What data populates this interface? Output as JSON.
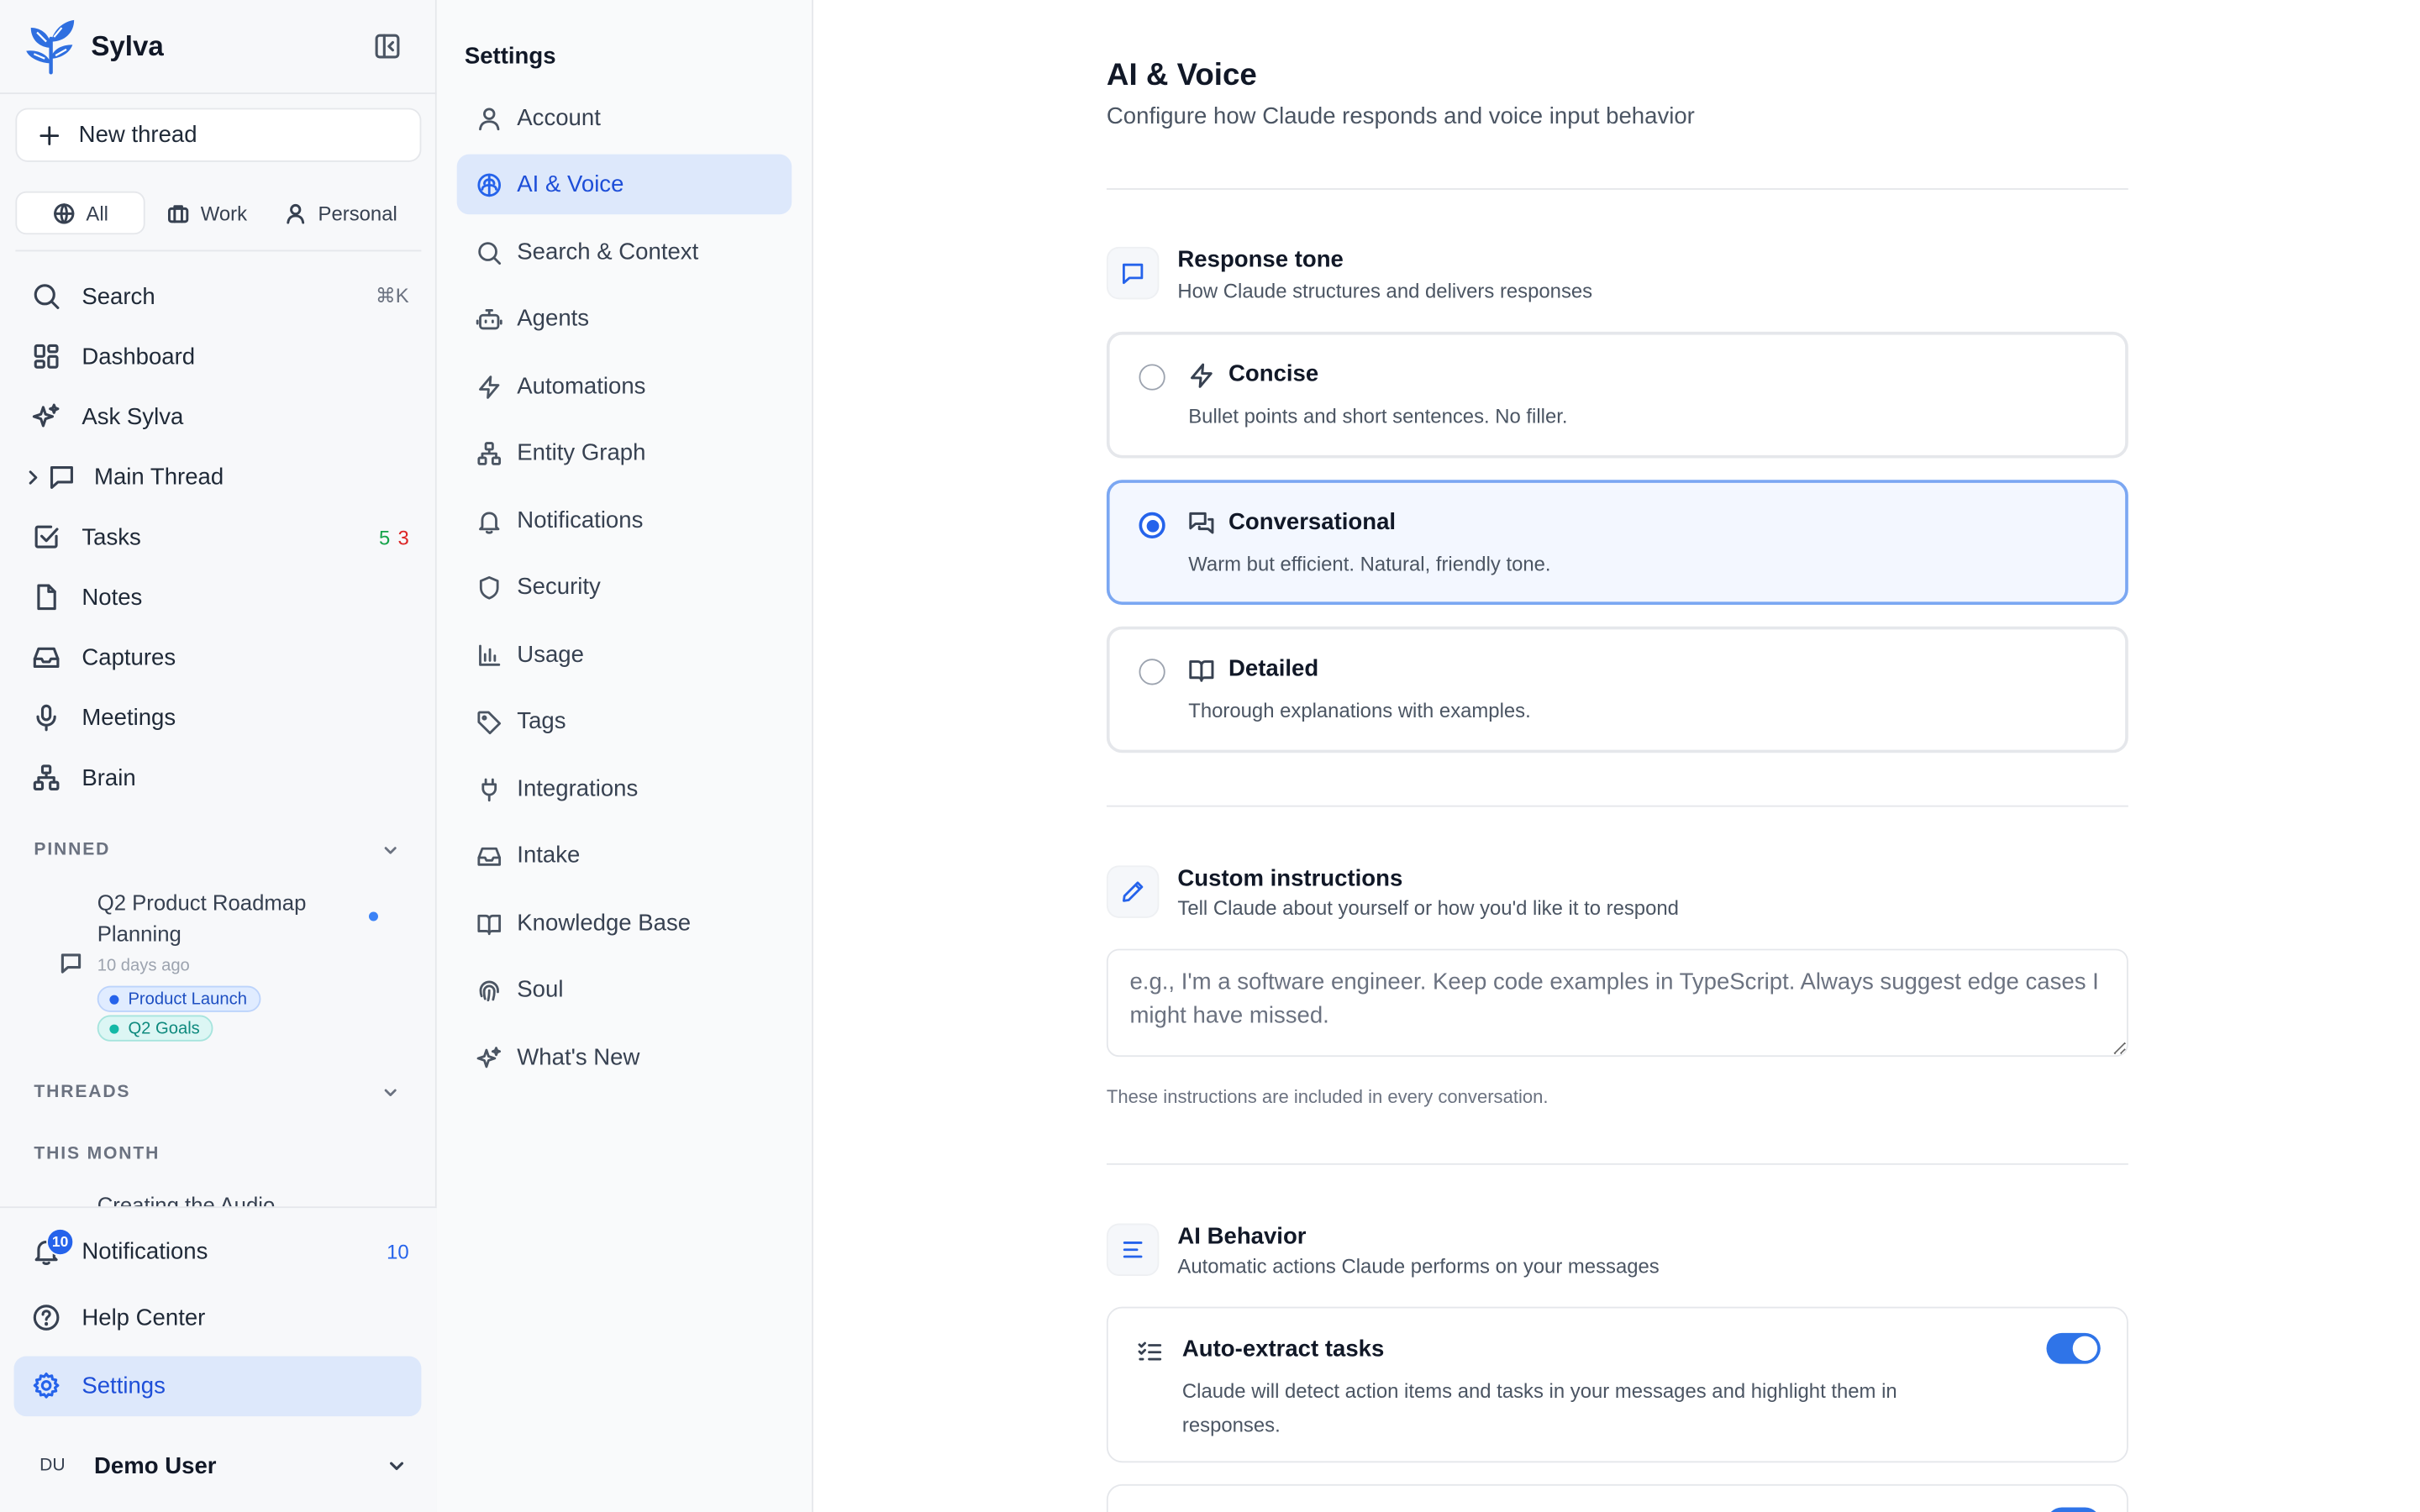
{
  "brand": {
    "name": "Sylva"
  },
  "sidebar": {
    "new_thread_label": "New thread",
    "filters": [
      {
        "label": "All",
        "icon": "globe-icon",
        "active": true
      },
      {
        "label": "Work",
        "icon": "briefcase-icon",
        "active": false
      },
      {
        "label": "Personal",
        "icon": "user-icon",
        "active": false
      }
    ],
    "nav": [
      {
        "label": "Search",
        "icon": "search-icon",
        "shortcut": "⌘K"
      },
      {
        "label": "Dashboard",
        "icon": "dashboard-icon"
      },
      {
        "label": "Ask Sylva",
        "icon": "sparkles-icon"
      },
      {
        "label": "Main Thread",
        "icon": "message-square-icon"
      },
      {
        "label": "Tasks",
        "icon": "check-square-icon",
        "count_done": "5",
        "count_open": "3"
      },
      {
        "label": "Notes",
        "icon": "file-icon"
      },
      {
        "label": "Captures",
        "icon": "inbox-icon"
      },
      {
        "label": "Meetings",
        "icon": "mic-icon"
      },
      {
        "label": "Brain",
        "icon": "network-icon"
      }
    ],
    "pinned": {
      "label": "PINNED",
      "item": {
        "title": "Q2 Product Roadmap Planning",
        "time": "10 days ago",
        "tags": [
          "Product Launch",
          "Q2 Goals"
        ]
      }
    },
    "threads_label": "THREADS",
    "this_month_label": "THIS MONTH",
    "cut_thread": "Creating the Audio",
    "bottom": {
      "notifications": {
        "label": "Notifications",
        "count": "10",
        "badge": "10"
      },
      "help": {
        "label": "Help Center"
      },
      "settings": {
        "label": "Settings"
      }
    },
    "user": {
      "initials": "DU",
      "name": "Demo User"
    }
  },
  "settings_nav": {
    "title": "Settings",
    "items": [
      {
        "label": "Account",
        "icon": "user-icon"
      },
      {
        "label": "AI & Voice",
        "icon": "brain-icon",
        "active": true
      },
      {
        "label": "Search & Context",
        "icon": "search-icon"
      },
      {
        "label": "Agents",
        "icon": "bot-icon"
      },
      {
        "label": "Automations",
        "icon": "zap-icon"
      },
      {
        "label": "Entity Graph",
        "icon": "network-icon"
      },
      {
        "label": "Notifications",
        "icon": "bell-icon"
      },
      {
        "label": "Security",
        "icon": "shield-icon"
      },
      {
        "label": "Usage",
        "icon": "bar-chart-icon"
      },
      {
        "label": "Tags",
        "icon": "tag-icon"
      },
      {
        "label": "Integrations",
        "icon": "plug-icon"
      },
      {
        "label": "Intake",
        "icon": "inbox-icon"
      },
      {
        "label": "Knowledge Base",
        "icon": "book-open-icon"
      },
      {
        "label": "Soul",
        "icon": "fingerprint-icon"
      },
      {
        "label": "What's New",
        "icon": "sparkles-icon"
      }
    ]
  },
  "main": {
    "title": "AI & Voice",
    "subtitle": "Configure how Claude responds and voice input behavior",
    "response_tone": {
      "title": "Response tone",
      "subtitle": "How Claude structures and delivers responses",
      "options": [
        {
          "title": "Concise",
          "desc": "Bullet points and short sentences. No filler.",
          "selected": false
        },
        {
          "title": "Conversational",
          "desc": "Warm but efficient. Natural, friendly tone.",
          "selected": true
        },
        {
          "title": "Detailed",
          "desc": "Thorough explanations with examples.",
          "selected": false
        }
      ]
    },
    "custom_instructions": {
      "title": "Custom instructions",
      "subtitle": "Tell Claude about yourself or how you'd like it to respond",
      "placeholder": "e.g., I'm a software engineer. Keep code examples in TypeScript. Always suggest edge cases I might have missed.",
      "help": "These instructions are included in every conversation."
    },
    "ai_behavior": {
      "title": "AI Behavior",
      "subtitle": "Automatic actions Claude performs on your messages",
      "toggles": [
        {
          "title": "Auto-extract tasks",
          "desc": "Claude will detect action items and tasks in your messages and highlight them in responses.",
          "on": true
        }
      ]
    }
  },
  "colors": {
    "accent": "#2563eb",
    "active_bg": "#dde8fb",
    "success": "#16a34a",
    "danger": "#dc2626"
  }
}
